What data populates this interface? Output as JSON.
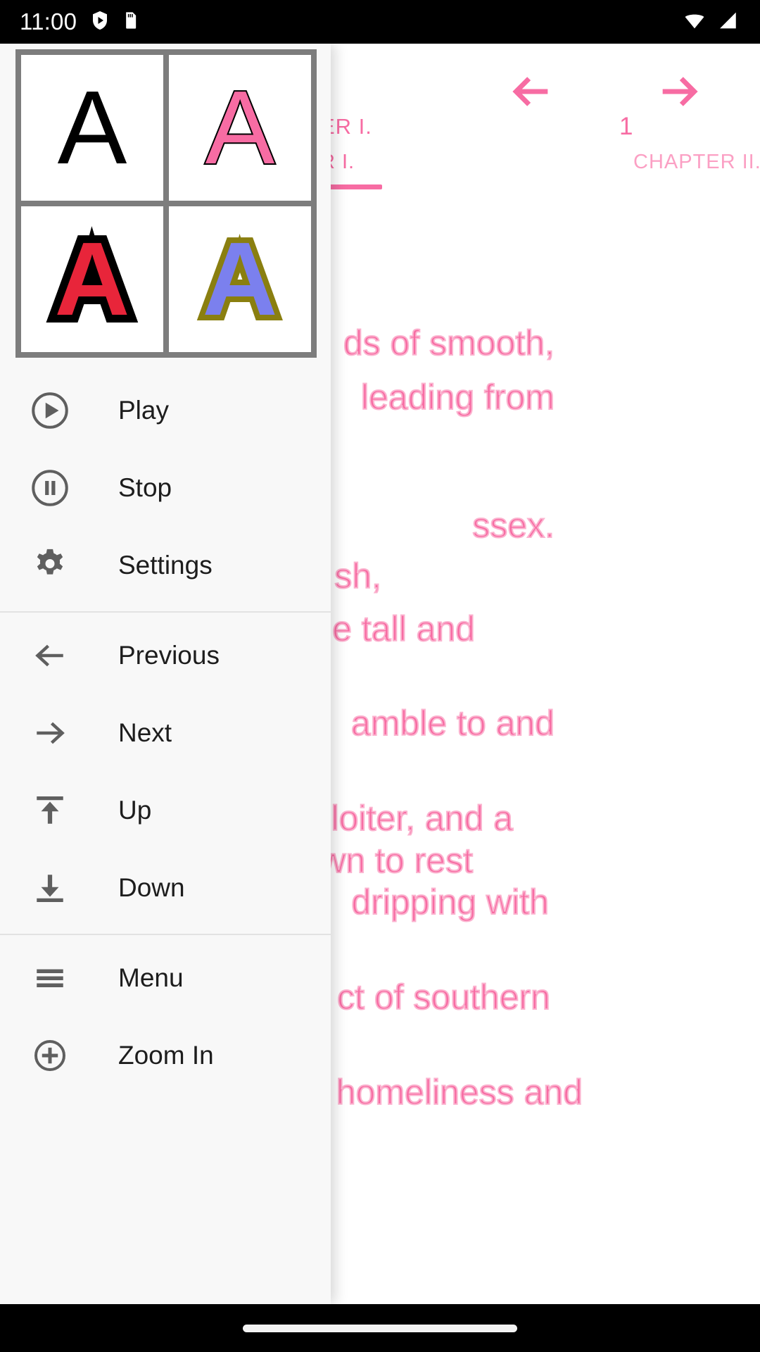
{
  "status_bar": {
    "time": "11:00",
    "left_icons": [
      "play-shield-icon",
      "sd-card-icon"
    ],
    "right_icons": [
      "wifi-icon",
      "cell-signal-icon"
    ]
  },
  "reader": {
    "prev_arrow_icon": "arrow-left-icon",
    "next_arrow_icon": "arrow-right-icon",
    "chapter_left": "ER I.",
    "page_number": "1",
    "tab_left": "R I.",
    "tab_right": "CHAPTER II.",
    "accent_color": "#f76ca3",
    "accent_light_color": "#fba0c4",
    "body_lines": [
      "ds of smooth,",
      "leading from",
      "ssex.",
      "sh,",
      "e tall and",
      "amble to and",
      "loiter, and a",
      "wn to rest",
      "dripping with",
      "ct of southern",
      "homeliness and"
    ]
  },
  "drawer": {
    "style_grid": {
      "name": "text-style-preview-grid",
      "cells": [
        {
          "letter": "A",
          "fill": "#000000",
          "stroke": "none"
        },
        {
          "letter": "A",
          "fill": "#f76ca3",
          "stroke": "#000000"
        },
        {
          "letter": "A",
          "fill": "#e8253a",
          "stroke": "#000000"
        },
        {
          "letter": "A",
          "fill": "#7b80ee",
          "stroke": "#8a7f10"
        }
      ],
      "border_color": "#7d7d7d"
    },
    "groups": [
      {
        "items": [
          {
            "label": "Play",
            "icon": "play-circle-icon"
          },
          {
            "label": "Stop",
            "icon": "pause-circle-icon"
          },
          {
            "label": "Settings",
            "icon": "gear-icon"
          }
        ]
      },
      {
        "items": [
          {
            "label": "Previous",
            "icon": "arrow-left-icon"
          },
          {
            "label": "Next",
            "icon": "arrow-right-icon"
          },
          {
            "label": "Up",
            "icon": "arrow-up-to-line-icon"
          },
          {
            "label": "Down",
            "icon": "arrow-down-to-line-icon"
          }
        ]
      },
      {
        "items": [
          {
            "label": "Menu",
            "icon": "hamburger-menu-icon"
          },
          {
            "label": "Zoom In",
            "icon": "zoom-in-circle-icon"
          }
        ]
      }
    ]
  },
  "nav_bar": {
    "handle": "gesture-home-handle"
  }
}
